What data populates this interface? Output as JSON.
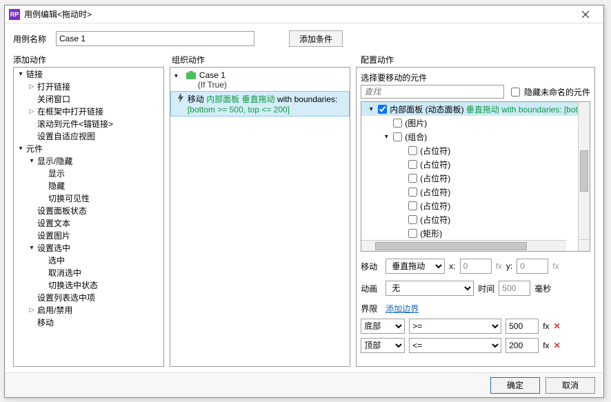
{
  "window": {
    "title": "用例编辑<拖动时>"
  },
  "caseName": {
    "label": "用例名称",
    "value": "Case 1"
  },
  "buttons": {
    "addCondition": "添加条件",
    "ok": "确定",
    "cancel": "取消"
  },
  "headers": {
    "addAction": "添加动作",
    "organize": "组织动作",
    "configure": "配置动作"
  },
  "leftTree": [
    {
      "lv": 0,
      "exp": "d",
      "label": "链接"
    },
    {
      "lv": 1,
      "exp": "r",
      "label": "打开链接"
    },
    {
      "lv": 1,
      "exp": "",
      "label": "关闭窗口"
    },
    {
      "lv": 1,
      "exp": "r",
      "label": "在框架中打开链接"
    },
    {
      "lv": 1,
      "exp": "",
      "label": "滚动到元件<锚链接>"
    },
    {
      "lv": 1,
      "exp": "",
      "label": "设置自适应视图"
    },
    {
      "lv": 0,
      "exp": "d",
      "label": "元件"
    },
    {
      "lv": 1,
      "exp": "d",
      "label": "显示/隐藏"
    },
    {
      "lv": 2,
      "exp": "",
      "label": "显示"
    },
    {
      "lv": 2,
      "exp": "",
      "label": "隐藏"
    },
    {
      "lv": 2,
      "exp": "",
      "label": "切换可见性"
    },
    {
      "lv": 1,
      "exp": "",
      "label": "设置面板状态"
    },
    {
      "lv": 1,
      "exp": "",
      "label": "设置文本"
    },
    {
      "lv": 1,
      "exp": "",
      "label": "设置图片"
    },
    {
      "lv": 1,
      "exp": "d",
      "label": "设置选中"
    },
    {
      "lv": 2,
      "exp": "",
      "label": "选中"
    },
    {
      "lv": 2,
      "exp": "",
      "label": "取消选中"
    },
    {
      "lv": 2,
      "exp": "",
      "label": "切换选中状态"
    },
    {
      "lv": 1,
      "exp": "",
      "label": "设置列表选中项"
    },
    {
      "lv": 1,
      "exp": "r",
      "label": "启用/禁用"
    },
    {
      "lv": 1,
      "exp": "",
      "label": "移动"
    }
  ],
  "case": {
    "name": "Case 1",
    "cond": "(If True)"
  },
  "action": {
    "verb": "移动",
    "target": "内部面板 垂直拖动",
    "with": "with boundaries:",
    "detail": "[bottom >= 500, top <= 200]"
  },
  "cfg": {
    "selectLabel": "选择要移动的元件",
    "searchPlaceholder": "查找",
    "hideUnnamed": "隐藏未命名的元件",
    "tree": {
      "root": {
        "name": "内部面板",
        "type": "(动态面板)",
        "extra": "垂直拖动 with boundaries: [bot"
      },
      "items": [
        "(图片)",
        "(组合)",
        "(占位符)",
        "(占位符)",
        "(占位符)",
        "(占位符)",
        "(占位符)",
        "(占位符)",
        "(矩形)"
      ]
    },
    "move": {
      "label": "移动",
      "mode": "垂直拖动",
      "xLabel": "x:",
      "xVal": "0",
      "yLabel": "y:",
      "yVal": "0"
    },
    "anim": {
      "label": "动画",
      "mode": "无",
      "timeLabel": "时间",
      "timeVal": "500",
      "unit": "毫秒"
    },
    "bounds": {
      "label": "界限",
      "addLink": "添加边界",
      "rows": [
        {
          "edge": "底部",
          "op": ">=",
          "val": "500"
        },
        {
          "edge": "顶部",
          "op": "<=",
          "val": "200"
        }
      ]
    }
  },
  "chart_data": null
}
